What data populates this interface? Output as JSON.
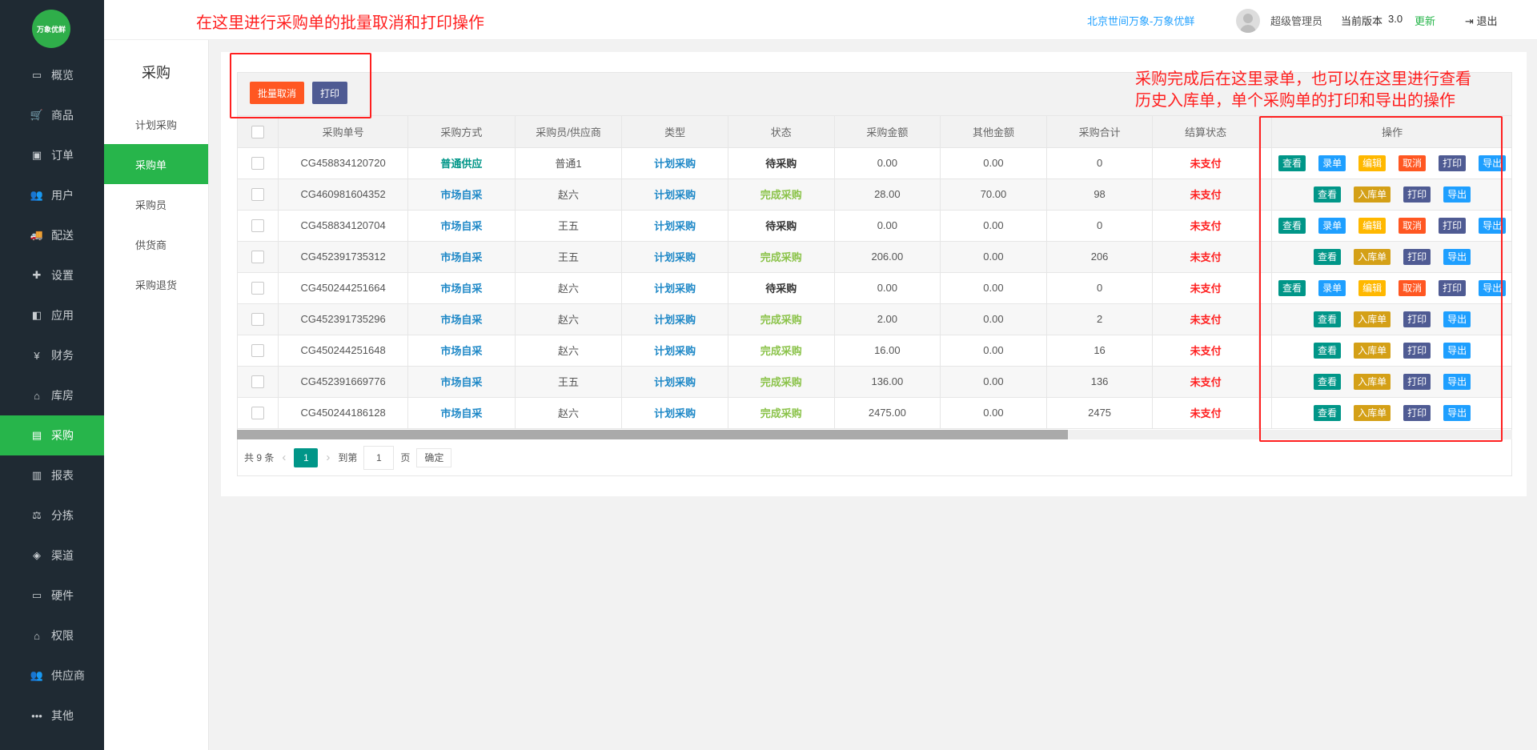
{
  "header": {
    "annotation": "在这里进行采购单的批量取消和打印操作",
    "company": "北京世间万象-万象优鲜",
    "admin": "超级管理员",
    "version_label": "当前版本",
    "version_num": "3.0",
    "update": "更新",
    "logout": "退出"
  },
  "logo_text": "万象优鲜",
  "sidebar": {
    "items": [
      {
        "label": "概览",
        "icon": "monitor-icon"
      },
      {
        "label": "商品",
        "icon": "cart-icon"
      },
      {
        "label": "订单",
        "icon": "money-icon"
      },
      {
        "label": "用户",
        "icon": "users-icon"
      },
      {
        "label": "配送",
        "icon": "truck-icon"
      },
      {
        "label": "设置",
        "icon": "puzzle-icon"
      },
      {
        "label": "应用",
        "icon": "apps-icon"
      },
      {
        "label": "财务",
        "icon": "yen-icon"
      },
      {
        "label": "库房",
        "icon": "home-icon"
      },
      {
        "label": "采购",
        "icon": "purchase-icon"
      },
      {
        "label": "报表",
        "icon": "chart-icon"
      },
      {
        "label": "分拣",
        "icon": "scale-icon"
      },
      {
        "label": "渠道",
        "icon": "cube-icon"
      },
      {
        "label": "硬件",
        "icon": "desktop-icon"
      },
      {
        "label": "权限",
        "icon": "bank-icon"
      },
      {
        "label": "供应商",
        "icon": "group-icon"
      },
      {
        "label": "其他",
        "icon": "more-icon"
      }
    ]
  },
  "submenu": {
    "title": "采购",
    "items": [
      "计划采购",
      "采购单",
      "采购员",
      "供货商",
      "采购退货"
    ]
  },
  "toolbar": {
    "batch_cancel": "批量取消",
    "print": "打印"
  },
  "annotation_right": "采购完成后在这里录单，也可以在这里进行查看历史入库单，单个采购单的打印和导出的操作",
  "table": {
    "headers": [
      "采购单号",
      "采购方式",
      "采购员/供应商",
      "类型",
      "状态",
      "采购金额",
      "其他金额",
      "采购合计",
      "结算状态",
      "操作"
    ],
    "rows": [
      {
        "no": "CG458834120720",
        "method": "普通供应",
        "buyer": "普通1",
        "type": "计划采购",
        "status": "待采购",
        "amount": "0.00",
        "other": "0.00",
        "total": "0",
        "settle": "未支付"
      },
      {
        "no": "CG460981604352",
        "method": "市场自采",
        "buyer": "赵六",
        "type": "计划采购",
        "status": "完成采购",
        "amount": "28.00",
        "other": "70.00",
        "total": "98",
        "settle": "未支付"
      },
      {
        "no": "CG458834120704",
        "method": "市场自采",
        "buyer": "王五",
        "type": "计划采购",
        "status": "待采购",
        "amount": "0.00",
        "other": "0.00",
        "total": "0",
        "settle": "未支付"
      },
      {
        "no": "CG452391735312",
        "method": "市场自采",
        "buyer": "王五",
        "type": "计划采购",
        "status": "完成采购",
        "amount": "206.00",
        "other": "0.00",
        "total": "206",
        "settle": "未支付"
      },
      {
        "no": "CG450244251664",
        "method": "市场自采",
        "buyer": "赵六",
        "type": "计划采购",
        "status": "待采购",
        "amount": "0.00",
        "other": "0.00",
        "total": "0",
        "settle": "未支付"
      },
      {
        "no": "CG452391735296",
        "method": "市场自采",
        "buyer": "赵六",
        "type": "计划采购",
        "status": "完成采购",
        "amount": "2.00",
        "other": "0.00",
        "total": "2",
        "settle": "未支付"
      },
      {
        "no": "CG450244251648",
        "method": "市场自采",
        "buyer": "赵六",
        "type": "计划采购",
        "status": "完成采购",
        "amount": "16.00",
        "other": "0.00",
        "total": "16",
        "settle": "未支付"
      },
      {
        "no": "CG452391669776",
        "method": "市场自采",
        "buyer": "王五",
        "type": "计划采购",
        "status": "完成采购",
        "amount": "136.00",
        "other": "0.00",
        "total": "136",
        "settle": "未支付"
      },
      {
        "no": "CG450244186128",
        "method": "市场自采",
        "buyer": "赵六",
        "type": "计划采购",
        "status": "完成采购",
        "amount": "2475.00",
        "other": "0.00",
        "total": "2475",
        "settle": "未支付"
      }
    ],
    "ops_pending": [
      "查看",
      "录单",
      "编辑",
      "取消",
      "打印",
      "导出"
    ],
    "ops_done": [
      "查看",
      "入库单",
      "打印",
      "导出"
    ]
  },
  "pager": {
    "total": "共 9 条",
    "current": "1",
    "goto_label": "到第",
    "goto_value": "1",
    "page_label": "页",
    "confirm": "确定"
  },
  "colors": {
    "sidebar_bg": "#1f2a33",
    "accent": "#27b54b",
    "danger": "#ff5722",
    "annotation": "#ff1f1f"
  }
}
